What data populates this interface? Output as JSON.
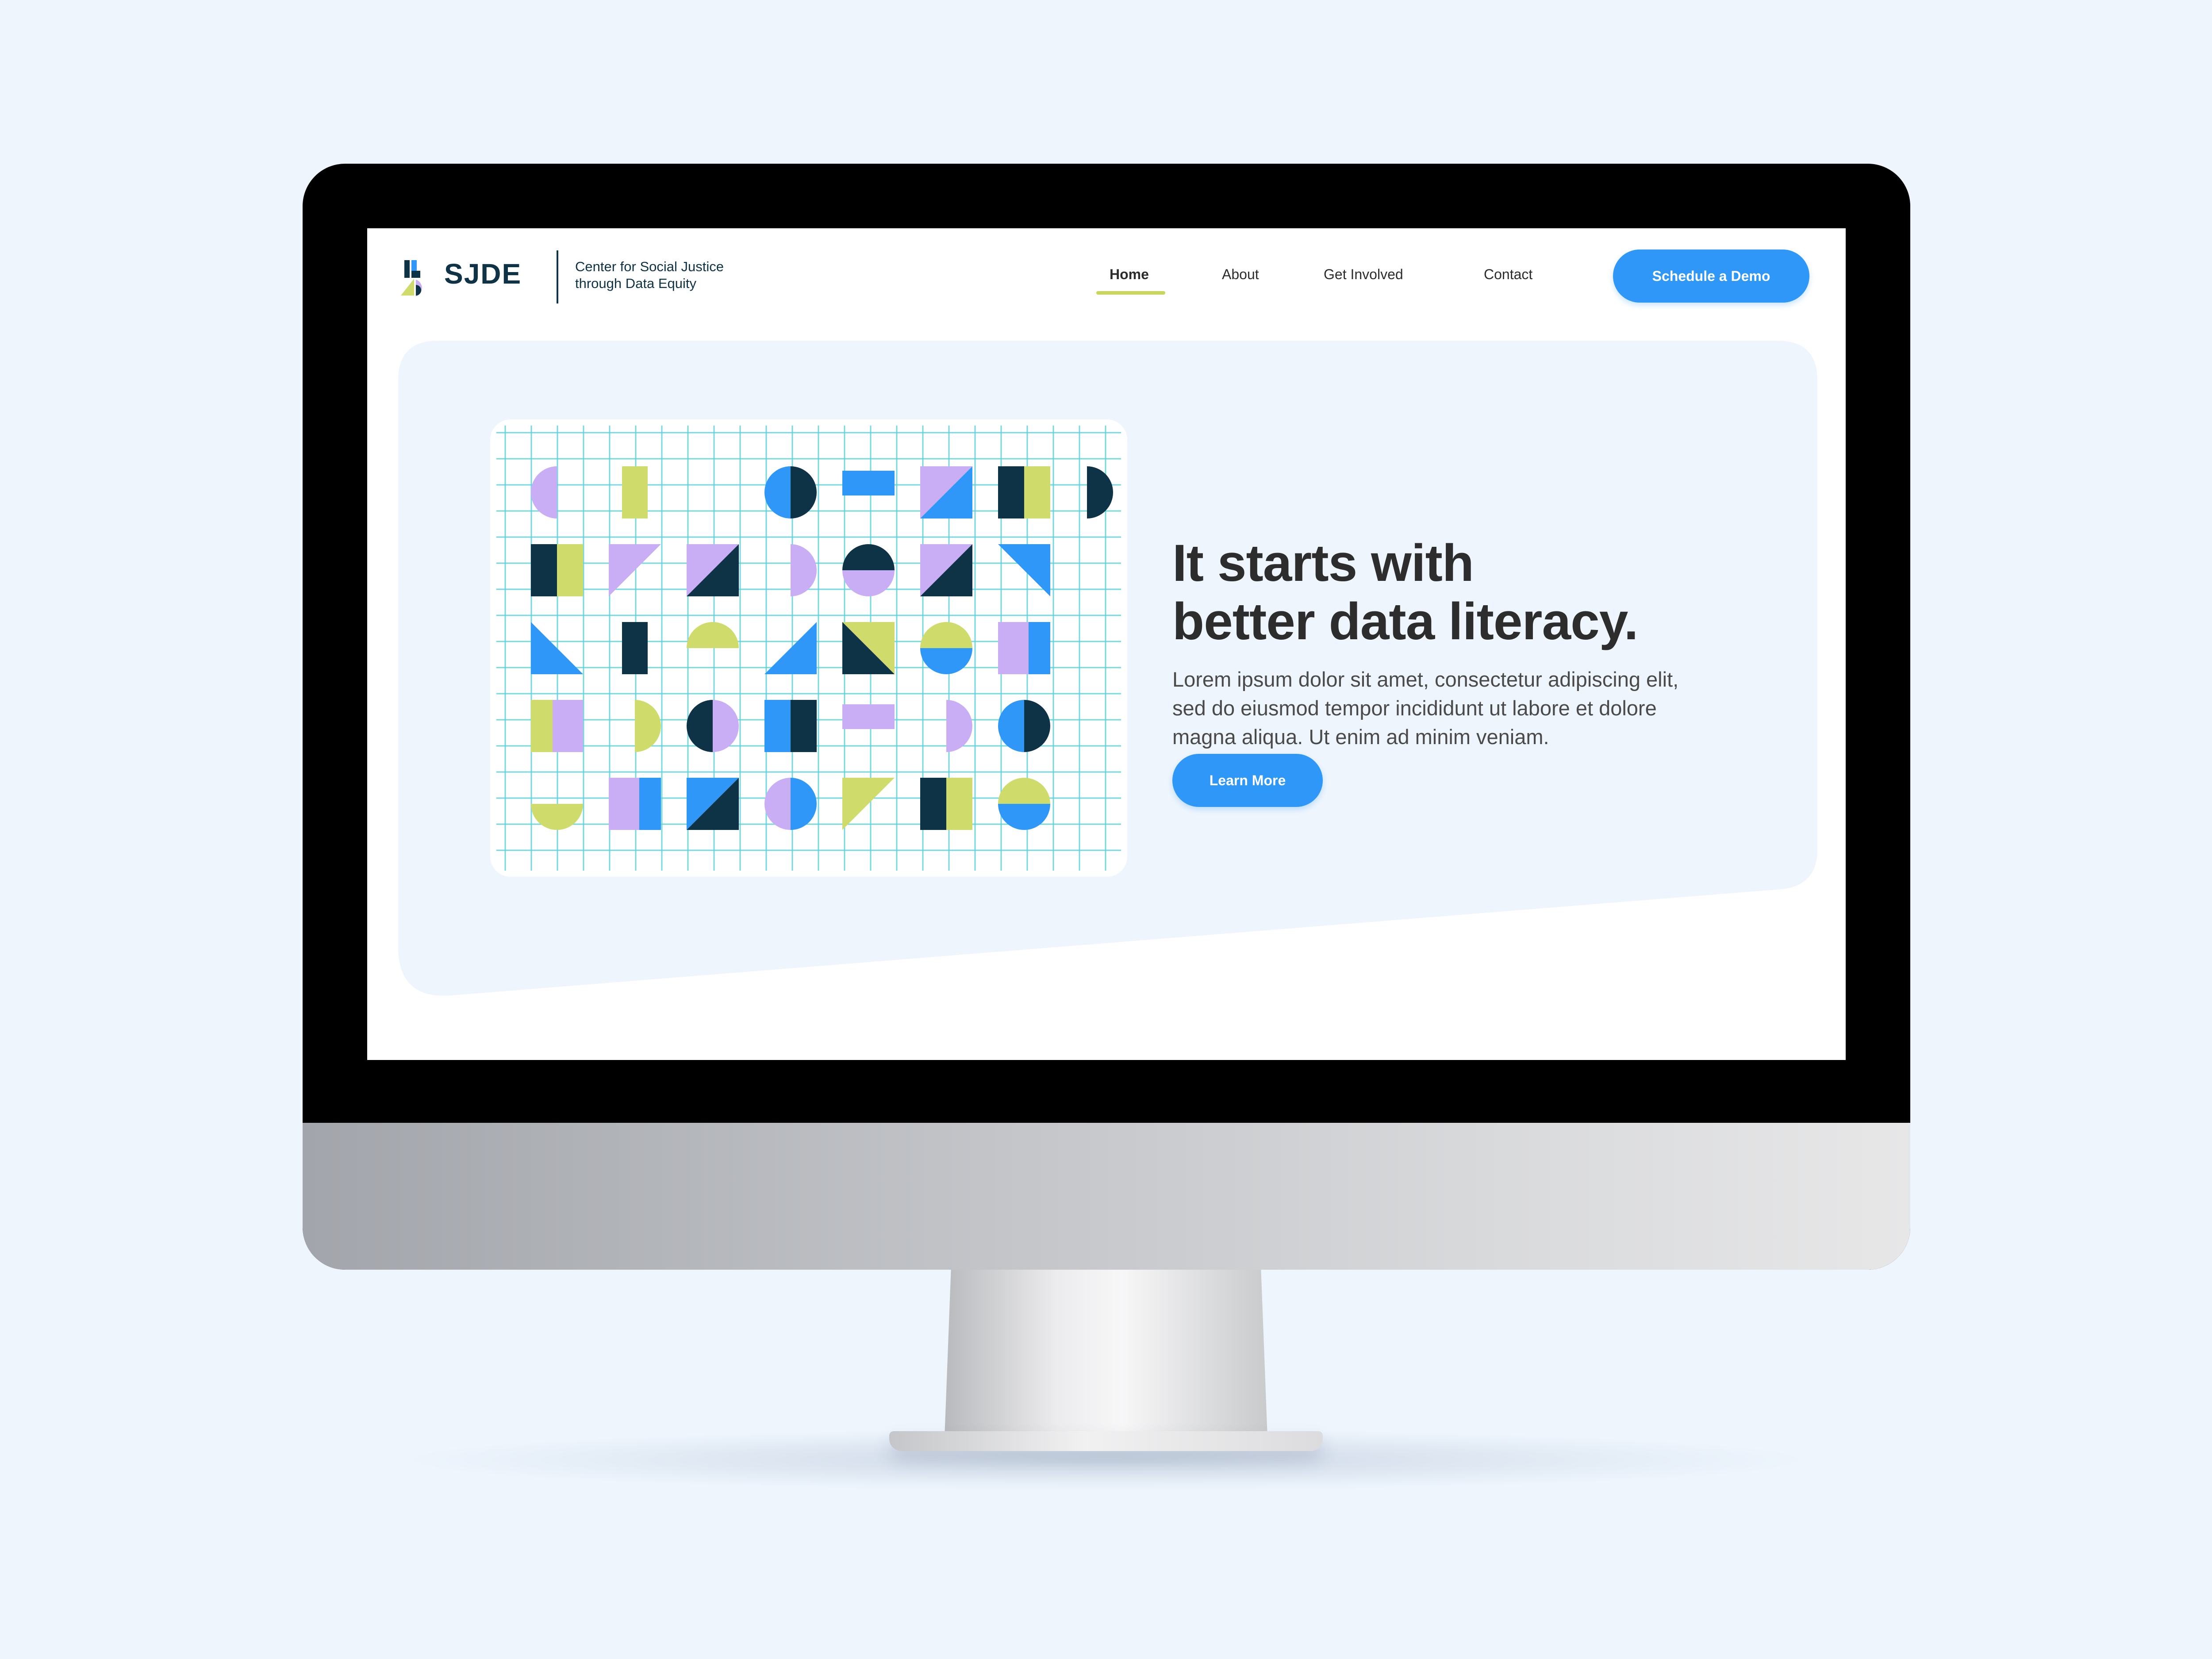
{
  "brand": {
    "logo_text": "SJDE",
    "tagline_line1": "Center for Social Justice",
    "tagline_line2": "through Data Equity"
  },
  "nav": {
    "items": [
      {
        "label": "Home",
        "active": true
      },
      {
        "label": "About",
        "active": false
      },
      {
        "label": "Get Involved",
        "active": false
      },
      {
        "label": "Contact",
        "active": false
      }
    ],
    "cta_label": "Schedule a Demo"
  },
  "hero": {
    "title_line1": "It starts with",
    "title_line2": "better data literacy.",
    "body_line1": "Lorem ipsum dolor sit amet, consectetur adipiscing elit,",
    "body_line2": "sed do eiusmod tempor incididunt ut labore et dolore",
    "body_line3": "magna aliqua. Ut enim ad minim veniam.",
    "button_label": "Learn More"
  },
  "colors": {
    "primary_blue": "#2e97f8",
    "navy": "#0e3347",
    "lime": "#cfdb6a",
    "lavender": "#c9aef5",
    "grid_cyan": "#5fd3dc",
    "hero_bg": "#eef5fd",
    "nav_underline": "#c8d65e"
  },
  "illustration": {
    "tiles": [
      [
        "half-circle-left-lavender",
        "bar-lime",
        "empty",
        "circle-blue-navy-vertical",
        "bar-blue-horizontal",
        "triangle-lavender-blue",
        "square-navy-lime",
        "half-circle-right-navy"
      ],
      [
        "square-navy-lime",
        "triangle-lavender",
        "triangle-lavender-navy",
        "half-circle-right-lavender",
        "circle-navy-lavender-horizontal",
        "triangle-lavender-navy",
        "triangle-blue",
        "empty"
      ],
      [
        "triangle-blue-left",
        "bar-navy",
        "half-circle-top-lime",
        "triangle-blue-right",
        "triangle-lime-navy",
        "circle-lime-blue-horizontal",
        "square-lavender-blue",
        "empty"
      ],
      [
        "square-lime-lavender",
        "half-circle-right-lime",
        "circle-navy-lavender-vertical",
        "square-blue-navy",
        "bar-lavender-horizontal",
        "half-circle-right-lavender",
        "circle-blue-navy-vertical",
        "empty"
      ],
      [
        "half-circle-bottom-lime",
        "square-lavender-blue",
        "triangle-blue-navy",
        "circle-blue-lavender-vertical",
        "triangle-lime",
        "square-navy-lime",
        "circle-lime-blue-horizontal",
        "empty"
      ]
    ]
  }
}
